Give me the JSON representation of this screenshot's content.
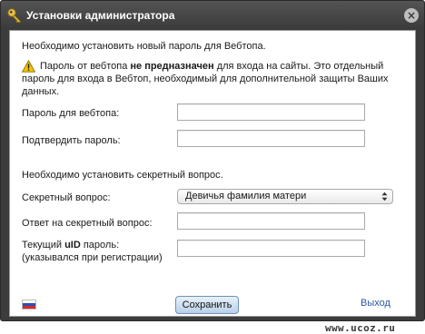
{
  "window": {
    "title": "Установки администратора",
    "close_glyph": "×"
  },
  "form": {
    "password_intro": "Необходимо установить новый пароль для Вебтопа.",
    "warning": {
      "prefix": "Пароль от вебтопа ",
      "emphasis": "не предназначен",
      "suffix": " для входа на сайты. Это отдельный пароль для входа в Вебтоп, необходимый для дополнительной защиты Ваших данных."
    },
    "password_label": "Пароль для вебтопа:",
    "password_value": "",
    "confirm_label": "Подтвердить пароль:",
    "confirm_value": "",
    "secret_intro": "Необходимо установить секретный вопрос.",
    "secret_question_label": "Секретный вопрос:",
    "secret_question_selected": "Девичья фамилия матери",
    "secret_answer_label": "Ответ на секретный вопрос:",
    "secret_answer_value": "",
    "uid_label_prefix": "Текущий ",
    "uid_label_bold": "uID",
    "uid_label_suffix": " пароль:",
    "uid_hint": "(указывался при регистрации)",
    "uid_value": ""
  },
  "footer": {
    "language_flag": "flag-ru-icon",
    "save_label": "Сохранить",
    "logout_label": "Выход"
  },
  "watermark": "www.ucoz.ru",
  "colors": {
    "titlebar": "#3c3c3c",
    "link": "#2a57a8",
    "warning": "#f3c200"
  }
}
